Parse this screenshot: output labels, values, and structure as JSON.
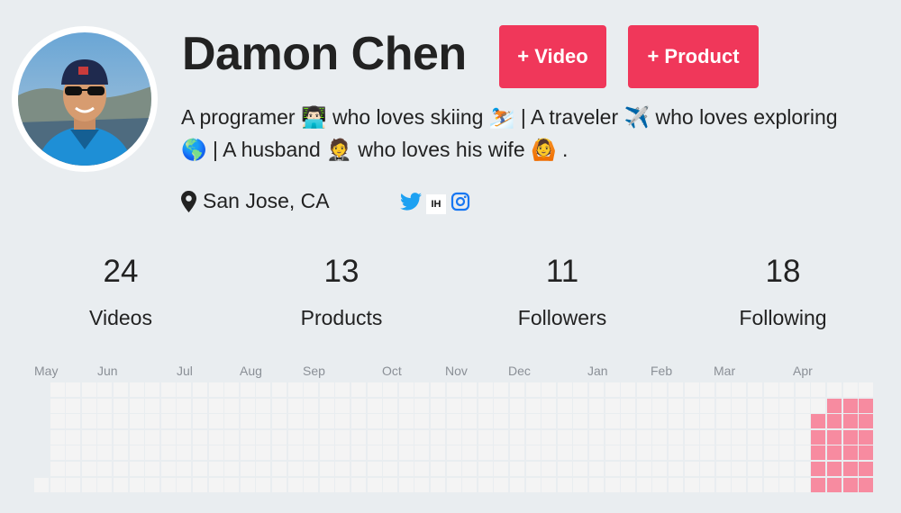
{
  "profile": {
    "name": "Damon Chen",
    "bio": "A programer 👨🏻‍💻  who loves skiing ⛷️  | A traveler ✈️  who loves exploring 🌎  | A husband 🤵 who loves his wife 🙆 .",
    "location": "San Jose, CA",
    "social_ih_label": "IH"
  },
  "actions": {
    "video_label": "+ Video",
    "product_label": "+ Product"
  },
  "stats": [
    {
      "value": "24",
      "label": "Videos"
    },
    {
      "value": "13",
      "label": "Products"
    },
    {
      "value": "11",
      "label": "Followers"
    },
    {
      "value": "18",
      "label": "Following"
    }
  ],
  "activity": {
    "months": [
      "May",
      "Jun",
      "Jul",
      "Aug",
      "Sep",
      "Oct",
      "Nov",
      "Dec",
      "Jan",
      "Feb",
      "Mar",
      "Apr"
    ],
    "weeks": 53,
    "active_color": "#f78ba0",
    "empty_color": "#f4f4f4"
  },
  "colors": {
    "accent": "#f0375a",
    "background": "#e9edf0",
    "twitter": "#1da1f2",
    "instagram": "#1877f2"
  },
  "icons": [
    "map-pin-icon",
    "twitter-icon",
    "indiehackers-icon",
    "instagram-icon"
  ]
}
